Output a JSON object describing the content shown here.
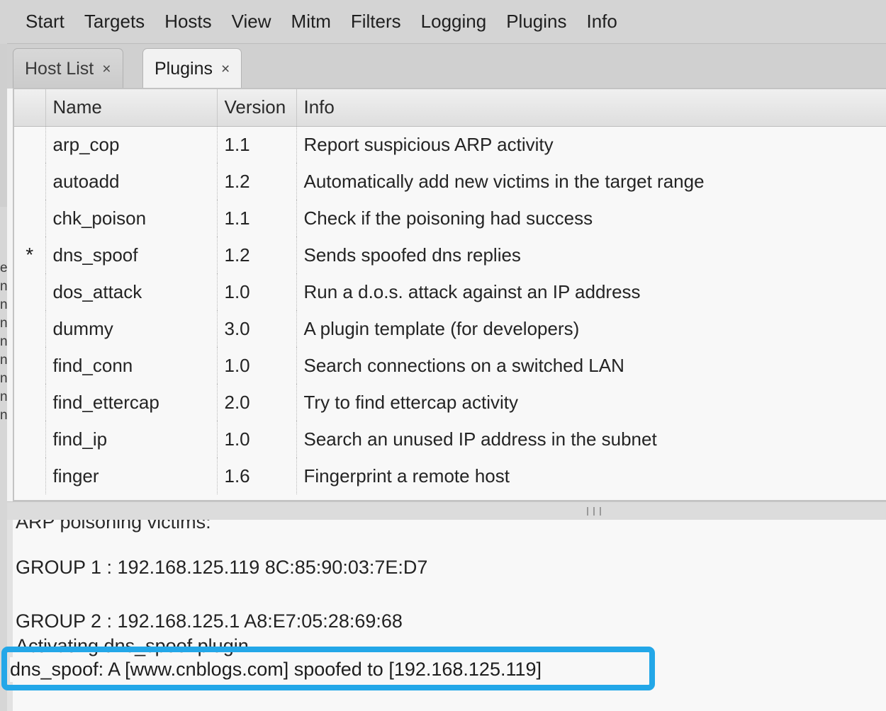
{
  "menubar": {
    "items": [
      {
        "label": "Start"
      },
      {
        "label": "Targets"
      },
      {
        "label": "Hosts"
      },
      {
        "label": "View"
      },
      {
        "label": "Mitm"
      },
      {
        "label": "Filters"
      },
      {
        "label": "Logging"
      },
      {
        "label": "Plugins"
      },
      {
        "label": "Info"
      }
    ]
  },
  "tabs": [
    {
      "label": "Host List",
      "close": "×",
      "active": false
    },
    {
      "label": "Plugins",
      "close": "×",
      "active": true
    }
  ],
  "plugin_table": {
    "columns": {
      "marker": "",
      "name": "Name",
      "version": "Version",
      "info": "Info"
    },
    "active_marker": "*",
    "rows": [
      {
        "marker": "",
        "name": "arp_cop",
        "version": "1.1",
        "info": "Report suspicious ARP activity"
      },
      {
        "marker": "",
        "name": "autoadd",
        "version": "1.2",
        "info": "Automatically add new victims in the target range"
      },
      {
        "marker": "",
        "name": "chk_poison",
        "version": "1.1",
        "info": "Check if the poisoning had success"
      },
      {
        "marker": "*",
        "name": "dns_spoof",
        "version": "1.2",
        "info": "Sends spoofed dns replies"
      },
      {
        "marker": "",
        "name": "dos_attack",
        "version": "1.0",
        "info": "Run a d.o.s. attack against an IP address"
      },
      {
        "marker": "",
        "name": "dummy",
        "version": "3.0",
        "info": "A plugin template (for developers)"
      },
      {
        "marker": "",
        "name": "find_conn",
        "version": "1.0",
        "info": "Search connections on a switched LAN"
      },
      {
        "marker": "",
        "name": "find_ettercap",
        "version": "2.0",
        "info": "Try to find ettercap activity"
      },
      {
        "marker": "",
        "name": "find_ip",
        "version": "1.0",
        "info": "Search an unused IP address in the subnet"
      },
      {
        "marker": "",
        "name": "finger",
        "version": "1.6",
        "info": "Fingerprint a remote host"
      }
    ]
  },
  "log": {
    "clipped_top_line": "ARP poisoning victims:",
    "lines": [
      "GROUP 1 : 192.168.125.119 8C:85:90:03:7E:D7",
      "GROUP 2 : 192.168.125.1 A8:E7:05:28:69:68",
      "Activating dns_spoof plugin..."
    ],
    "highlighted_line": "dns_spoof: A [www.cnblogs.com] spoofed to [192.168.125.119]"
  },
  "annotation": {
    "color": "#23A7E8"
  }
}
